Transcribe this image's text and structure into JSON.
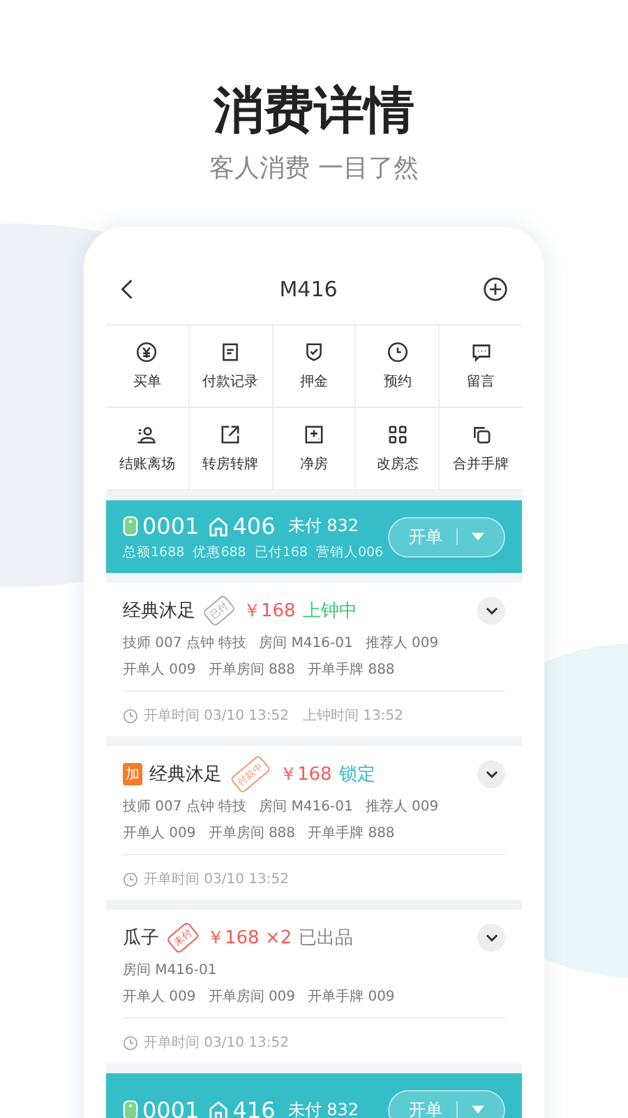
{
  "title": "消费详情",
  "subtitle": "客人消费 一目了然",
  "nav": {
    "title": "M416"
  },
  "actions": [
    {
      "label": "买单",
      "kind": "yen"
    },
    {
      "label": "付款记录",
      "kind": "doc"
    },
    {
      "label": "押金",
      "kind": "shield"
    },
    {
      "label": "预约",
      "kind": "clock"
    },
    {
      "label": "留言",
      "kind": "chat"
    },
    {
      "label": "结账离场",
      "kind": "person"
    },
    {
      "label": "转房转牌",
      "kind": "share"
    },
    {
      "label": "净房",
      "kind": "plusbox"
    },
    {
      "label": "改房态",
      "kind": "grid"
    },
    {
      "label": "合并手牌",
      "kind": "copy"
    }
  ],
  "groups": [
    {
      "tag": "0001",
      "room": "406",
      "unpaid": "未付 832",
      "stats": [
        "总额1688",
        "优惠688",
        "已付168",
        "营销人006"
      ],
      "button": "开单",
      "items": [
        {
          "added": false,
          "name": "经典沐足",
          "stamp": {
            "text": "已付",
            "kind": "paid"
          },
          "price": "￥168",
          "status": {
            "text": "上钟中",
            "kind": "serving"
          },
          "lines": [
            [
              "技师 007 点钟 特技",
              "房间 M416-01",
              "推荐人 009"
            ],
            [
              "开单人 009",
              "开单房间 888",
              "开单手牌 888"
            ]
          ],
          "times": [
            "开单时间 03/10 13:52",
            "上钟时间 13:52"
          ]
        },
        {
          "added": true,
          "added_label": "加",
          "name": "经典沐足",
          "stamp": {
            "text": "付款中",
            "kind": "paying"
          },
          "price": "￥168",
          "status": {
            "text": "锁定",
            "kind": "locked"
          },
          "lines": [
            [
              "技师 007 点钟 特技",
              "房间 M416-01",
              "推荐人 009"
            ],
            [
              "开单人 009",
              "开单房间 888",
              "开单手牌 888"
            ]
          ],
          "times": [
            "开单时间 03/10 13:52"
          ]
        },
        {
          "added": false,
          "name": "瓜子",
          "stamp": {
            "text": "未付",
            "kind": "unpaid"
          },
          "price": "￥168 ×2",
          "status": {
            "text": "已出品",
            "kind": "done"
          },
          "lines": [
            [
              "房间 M416-01"
            ],
            [
              "开单人 009",
              "开单房间 009",
              "开单手牌 009"
            ]
          ],
          "times": [
            "开单时间 03/10 13:52"
          ]
        }
      ]
    },
    {
      "tag": "0001",
      "room": "416",
      "unpaid": "未付 832",
      "button": "开单"
    }
  ]
}
